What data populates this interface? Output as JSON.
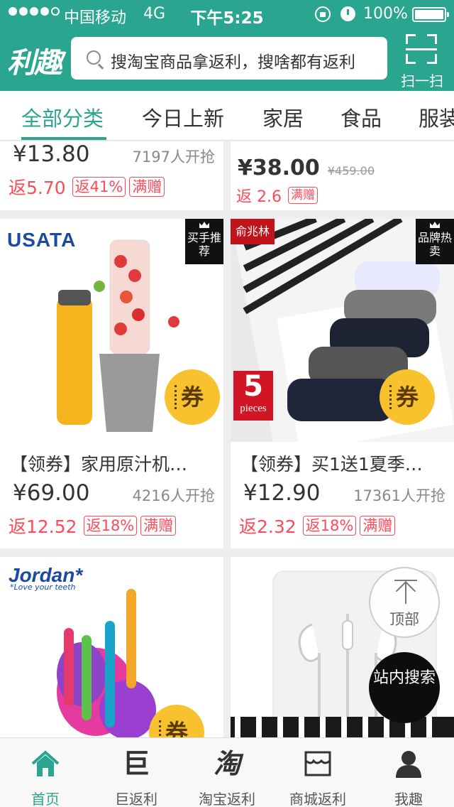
{
  "status_bar": {
    "carrier": "中国移动",
    "network": "4G",
    "time": "下午5:25",
    "battery": "100%"
  },
  "header": {
    "logo": "利趣",
    "search_placeholder": "搜淘宝商品拿返利，搜啥都有返利",
    "scan_label": "扫一扫"
  },
  "tabs": [
    {
      "label": "全部分类",
      "active": true
    },
    {
      "label": "今日上新"
    },
    {
      "label": "家居"
    },
    {
      "label": "食品"
    },
    {
      "label": "服装"
    }
  ],
  "products": [
    {
      "price": "¥13.80",
      "sold": "7197人开抢",
      "rebate": "返5.70",
      "tags": [
        "返41%",
        "满赠"
      ]
    },
    {
      "price": "¥38.00",
      "original_price": "¥459.00",
      "rebate": "返 2.6",
      "tags": [
        "满赠"
      ]
    },
    {
      "brand": "USATA",
      "badge": "买手推荐",
      "coupon": "券",
      "title": "【领券】家用原汁机…",
      "price": "¥69.00",
      "sold": "4216人开抢",
      "rebate": "返12.52",
      "tags": [
        "返18%",
        "满赠"
      ]
    },
    {
      "brand": "俞兆林",
      "badge": "品牌热卖",
      "pieces": "5",
      "pieces_label": "pieces",
      "coupon": "券",
      "title": "【领券】买1送1夏季…",
      "price": "¥12.90",
      "sold": "17361人开抢",
      "rebate": "返2.32",
      "tags": [
        "返18%",
        "满赠"
      ]
    },
    {
      "brand": "Jordan*",
      "brand_tagline": "*Love your teeth",
      "coupon": "券"
    },
    {
      "title": ""
    }
  ],
  "floating": {
    "to_top": "顶部",
    "site_search": "站内搜索"
  },
  "bottom_nav": [
    {
      "label": "首页",
      "icon": "home-icon",
      "active": true
    },
    {
      "label": "巨返利",
      "icon": "ju-icon",
      "glyph": "巨"
    },
    {
      "label": "淘宝返利",
      "icon": "tao-icon",
      "glyph": "淘"
    },
    {
      "label": "商城返利",
      "icon": "mall-icon"
    },
    {
      "label": "我趣",
      "icon": "user-icon"
    }
  ],
  "colors": {
    "brand": "#2aa58f",
    "rebate_red": "#ff4a5a",
    "coupon_yellow": "#f7c22e"
  }
}
